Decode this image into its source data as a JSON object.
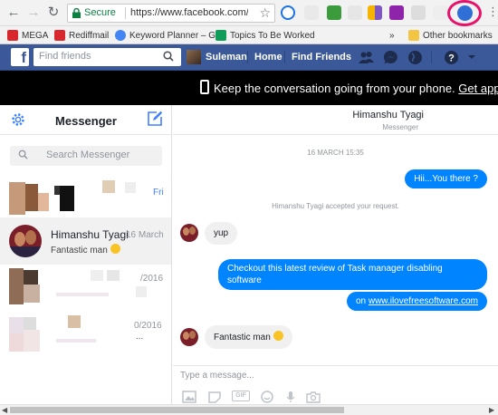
{
  "browser": {
    "secure_label": "Secure",
    "url": "https://www.facebook.com/me",
    "bookmarks": [
      "MEGA",
      "Rediffmail",
      "Keyword Planner – Go",
      "Topics To Be Worked",
      "Other bookmarks"
    ],
    "more": "»"
  },
  "fb": {
    "logo": "f",
    "search_placeholder": "Find friends",
    "user": "Suleman",
    "home": "Home",
    "find_friends": "Find Friends"
  },
  "notice": {
    "text": "Keep the conversation going from your phone.",
    "link": "Get app"
  },
  "messenger": {
    "title": "Messenger",
    "search_placeholder": "Search Messenger",
    "conversations": [
      {
        "date": "Fri"
      },
      {
        "name": "Himanshu Tyagi",
        "date": "16 March",
        "snippet": "Fantastic man"
      },
      {
        "date": "/2016"
      },
      {
        "date": "0/2016",
        "snippet": "..."
      }
    ]
  },
  "chat": {
    "contact_name": "Himanshu Tyagi",
    "contact_status": "Messenger",
    "timestamp": "16 MARCH 15:35",
    "system_message": "Himanshu Tyagi accepted your request.",
    "messages": [
      {
        "text": "Hii...You there ?"
      },
      {
        "text": "yup"
      },
      {
        "line1": "Checkout this latest review of Task manager disabling",
        "line2": "software"
      },
      {
        "prefix": "on ",
        "link": "www.ilovefreesoftware.com"
      },
      {
        "text": "Fantastic man"
      }
    ],
    "composer_placeholder": "Type a message...",
    "gif_label": "GIF"
  },
  "colors": {
    "facebook_blue": "#3b5998",
    "messenger_blue": "#0084ff",
    "highlight": "#e8126b"
  }
}
